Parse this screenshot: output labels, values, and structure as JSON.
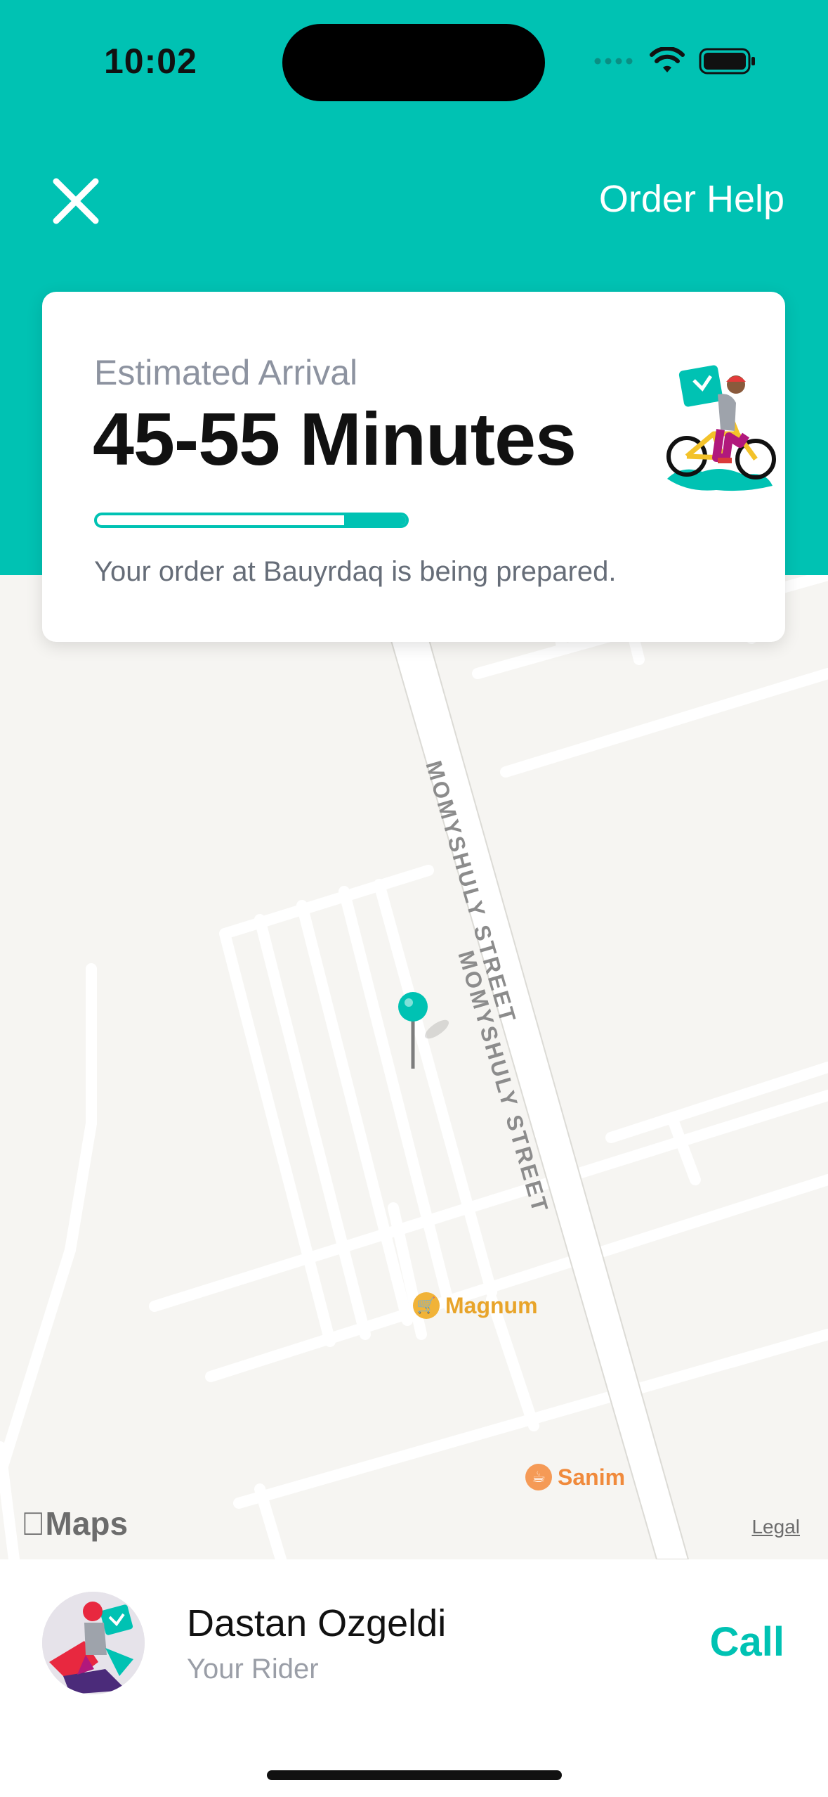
{
  "status_bar": {
    "time": "10:02"
  },
  "header": {
    "close_icon": "close-icon",
    "order_help_label": "Order Help"
  },
  "eta_card": {
    "label": "Estimated Arrival",
    "value": "45-55 Minutes",
    "progress": 0.2,
    "status_text": "Your order at Bauyrdaq is being prepared."
  },
  "map": {
    "street_labels": [
      "MOMYSHULY STREET",
      "MOMYSHULY STREET"
    ],
    "pois": [
      {
        "name": "Magnum",
        "icon": "shopping-cart-icon",
        "color": "#e8a42a"
      },
      {
        "name": "Sanim",
        "icon": "cup-icon",
        "color": "#f08a3c"
      }
    ],
    "attribution": "Maps",
    "legal_label": "Legal"
  },
  "rider": {
    "name": "Dastan Ozgeldi",
    "role": "Your Rider",
    "call_label": "Call"
  },
  "colors": {
    "accent": "#00c2b3"
  }
}
